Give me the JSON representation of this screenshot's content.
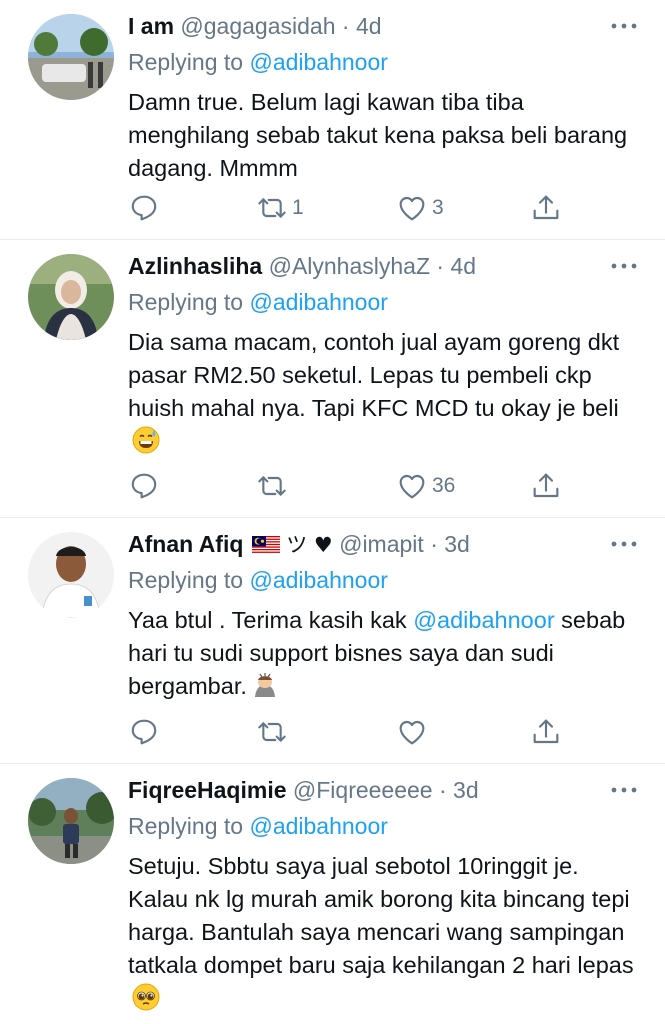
{
  "reply_prefix": "Replying to",
  "tweets": [
    {
      "name": "I am",
      "handle": "@gagagasidah",
      "time": "· 4d",
      "reply_to": "@adibahnoor",
      "text": "Damn true. Belum lagi kawan tiba tiba menghilang sebab takut kena paksa beli barang dagang. Mmmm",
      "retweets": "1",
      "likes": "3"
    },
    {
      "name": "Azlinhasliha",
      "handle": "@AlynhaslyhaZ",
      "time": "· 4d",
      "reply_to": "@adibahnoor",
      "text": "Dia sama macam, contoh jual ayam goreng dkt pasar RM2.50 seketul. Lepas tu pembeli ckp huish mahal nya. Tapi KFC MCD tu okay je beli",
      "retweets": "",
      "likes": "36"
    },
    {
      "name": "Afnan Afiq",
      "name_suffix": "ツ ♥",
      "handle": "@imapit",
      "time": "· 3d",
      "reply_to": "@adibahnoor",
      "text_a": "Yaa btul . Terima kasih kak ",
      "text_mention": "@adibahnoor",
      "text_b": " sebab hari tu sudi support bisnes saya dan sudi bergambar.",
      "retweets": "",
      "likes": ""
    },
    {
      "name": "FiqreeHaqimie",
      "handle": "@Fiqreeeeee",
      "time": "· 3d",
      "reply_to": "@adibahnoor",
      "text": "Setuju. Sbbtu saya jual sebotol 10ringgit je. Kalau nk lg murah amik borong kita bincang tepi harga. Bantulah saya mencari wang sampingan tatkala dompet baru saja kehilangan 2 hari lepas"
    }
  ],
  "icons": {
    "reply": "reply-icon",
    "retweet": "retweet-icon",
    "like": "heart-icon",
    "share": "share-icon",
    "more": "more-icon"
  },
  "colors": {
    "accent": "#1da1f2",
    "muted": "#657786",
    "text": "#0f1419",
    "divider": "#e6ecf0"
  }
}
